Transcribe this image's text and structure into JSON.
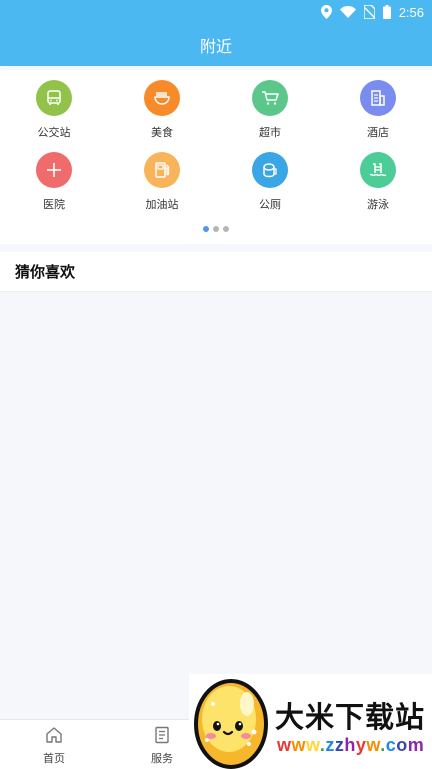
{
  "status_bar": {
    "time": "2:56"
  },
  "header": {
    "title": "附近"
  },
  "categories": [
    {
      "label": "公交站",
      "icon": "bus-icon",
      "color": "#93c24b"
    },
    {
      "label": "美食",
      "icon": "food-icon",
      "color": "#f88a2a"
    },
    {
      "label": "超市",
      "icon": "cart-icon",
      "color": "#5cc78a"
    },
    {
      "label": "酒店",
      "icon": "hotel-icon",
      "color": "#7b8cf0"
    },
    {
      "label": "医院",
      "icon": "hospital-icon",
      "color": "#f06b6b"
    },
    {
      "label": "加油站",
      "icon": "fuel-icon",
      "color": "#f9b35a"
    },
    {
      "label": "公厕",
      "icon": "toilet-icon",
      "color": "#3aa6e6"
    },
    {
      "label": "游泳",
      "icon": "swim-icon",
      "color": "#4ccc97"
    }
  ],
  "pager": {
    "page_count": 3,
    "active_index": 0
  },
  "section": {
    "title": "猜你喜欢"
  },
  "tabbar": {
    "items": [
      {
        "label": "首页",
        "icon": "home-icon"
      },
      {
        "label": "服务",
        "icon": "service-icon"
      }
    ]
  },
  "watermark": {
    "title": "大米下载站",
    "url": "www.zzhyw.com"
  }
}
